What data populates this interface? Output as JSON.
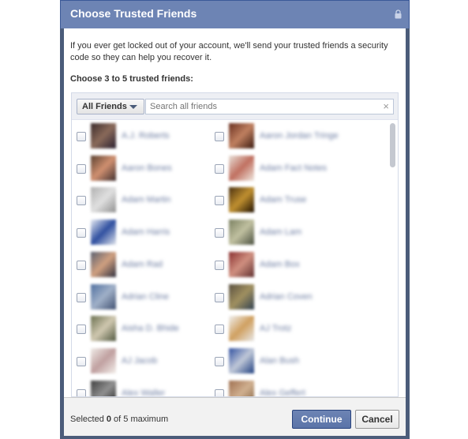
{
  "dialog": {
    "title": "Choose Trusted Friends",
    "intro": "If you ever get locked out of your account, we'll send your trusted friends a security code so they can help you recover it.",
    "choose_label": "Choose 3 to 5 trusted friends:"
  },
  "picker": {
    "filter_label": "All Friends",
    "search_placeholder": "Search all friends",
    "clear_symbol": "×"
  },
  "friends": [
    {
      "name": "A.J. Roberts"
    },
    {
      "name": "Aaron Jordan Tringe"
    },
    {
      "name": "Aaron Bones"
    },
    {
      "name": "Adam Fact Notes"
    },
    {
      "name": "Adam Martin"
    },
    {
      "name": "Adam Truse"
    },
    {
      "name": "Adam Harris"
    },
    {
      "name": "Adam Lam"
    },
    {
      "name": "Adam Rad"
    },
    {
      "name": "Adam Box"
    },
    {
      "name": "Adrian Cline"
    },
    {
      "name": "Adrian Coven"
    },
    {
      "name": "Aisha D. Bhide"
    },
    {
      "name": "AJ Trotz"
    },
    {
      "name": "AJ Jacob"
    },
    {
      "name": "Alan Bush"
    },
    {
      "name": "Alex Waller"
    },
    {
      "name": "Alex Geffert"
    }
  ],
  "footer": {
    "selected_prefix": "Selected ",
    "selected_count": "0",
    "selected_suffix": " of 5 maximum",
    "continue_label": "Continue",
    "cancel_label": "Cancel"
  },
  "colors": {
    "header_blue": "#6d84b4",
    "dialog_frame": "#4b5c7a",
    "button_primary": "#5b74a8",
    "link_blue": "#6b7ba0"
  },
  "icons": {
    "lock": "lock-icon",
    "dropdown": "chevron-down-icon",
    "clear": "close-icon"
  }
}
